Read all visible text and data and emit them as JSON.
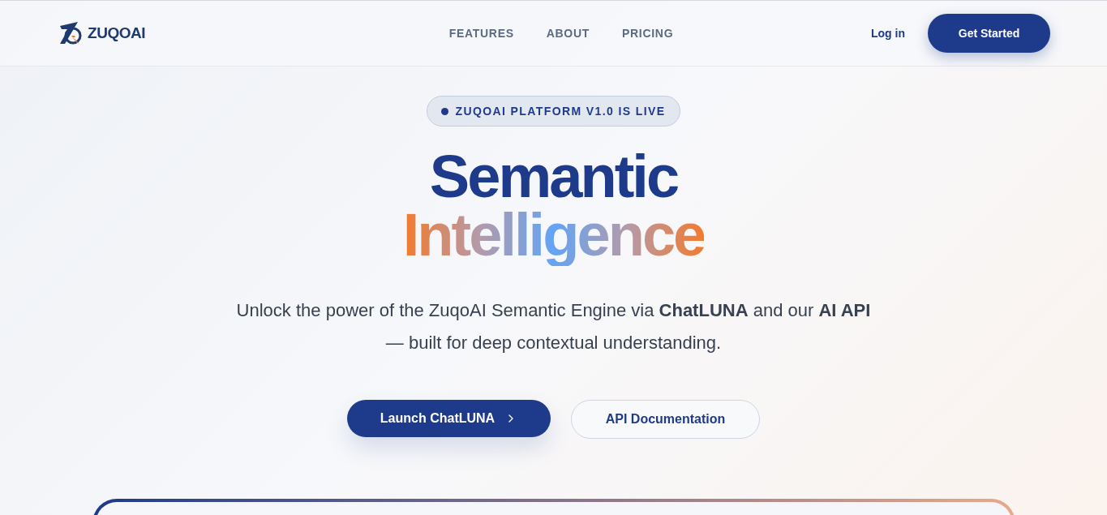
{
  "header": {
    "logo_text": "ZUQOAI",
    "nav": [
      {
        "label": "FEATURES"
      },
      {
        "label": "ABOUT"
      },
      {
        "label": "PRICING"
      }
    ],
    "login": "Log in",
    "cta": "Get Started"
  },
  "hero": {
    "badge": "ZUQOAI PLATFORM V1.0 IS LIVE",
    "title_line_1": "Semantic",
    "title_line_2": "Intelligence",
    "subtitle": "Unlock the power of the ZuqoAI Semantic Engine via **ChatLUNA** and our **AI API** — built for deep contextual understanding.",
    "primary_button": "Launch ChatLUNA",
    "secondary_button": "API Documentation"
  }
}
